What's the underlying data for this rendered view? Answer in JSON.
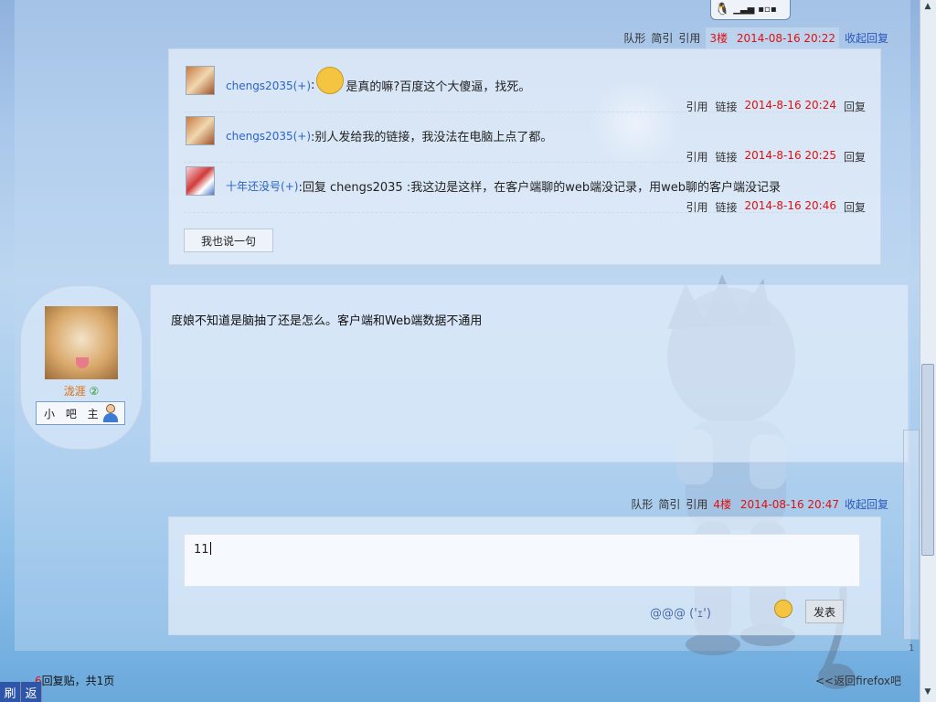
{
  "floor3": {
    "meta": [
      "队形",
      "简引",
      "引用"
    ],
    "floor_label": "3楼",
    "time": "2014-08-16 20:22",
    "collapse": "收起回复"
  },
  "comments": [
    {
      "user": "chengs2035",
      "suffix": "(+)",
      "text": "是真的嘛?百度这个大傻逼，找死。",
      "has_emoji": true,
      "quote": "引用",
      "link": "链接",
      "time": "2014-8-16 20:24",
      "reply": "回复"
    },
    {
      "user": "chengs2035",
      "suffix": "(+)",
      "text": ":别人发给我的链接，我没法在电脑上点了都。",
      "has_emoji": false,
      "quote": "引用",
      "link": "链接",
      "time": "2014-8-16 20:25",
      "reply": "回复"
    },
    {
      "user": "十年还没号",
      "suffix": "(+)",
      "text": ":回复 chengs2035 :我这边是这样，在客户端聊的web端没记录，用web聊的客户端没记录",
      "has_emoji": false,
      "quote": "引用",
      "link": "链接",
      "time": "2014-8-16 20:46",
      "reply": "回复"
    }
  ],
  "say_button": "我也说一句",
  "author": {
    "name": "泷涯",
    "level": "②",
    "role": "小 吧 主"
  },
  "post": {
    "content": "度娘不知道是脑抽了还是怎么。客户端和Web端数据不通用"
  },
  "floor4": {
    "meta": [
      "队形",
      "简引",
      "引用"
    ],
    "floor_label": "4楼",
    "time": "2014-08-16 20:47",
    "collapse": "收起回复"
  },
  "reply": {
    "input_value": "11",
    "emoticon_text": "@@@ ('ｪ')",
    "publish": "发表"
  },
  "footer": {
    "count": "6",
    "count_text": "回复贴，共1页",
    "back_link": "<<返回firefox吧"
  },
  "bottom_buttons": [
    "刷",
    "返"
  ],
  "scrollbar_label": "1"
}
